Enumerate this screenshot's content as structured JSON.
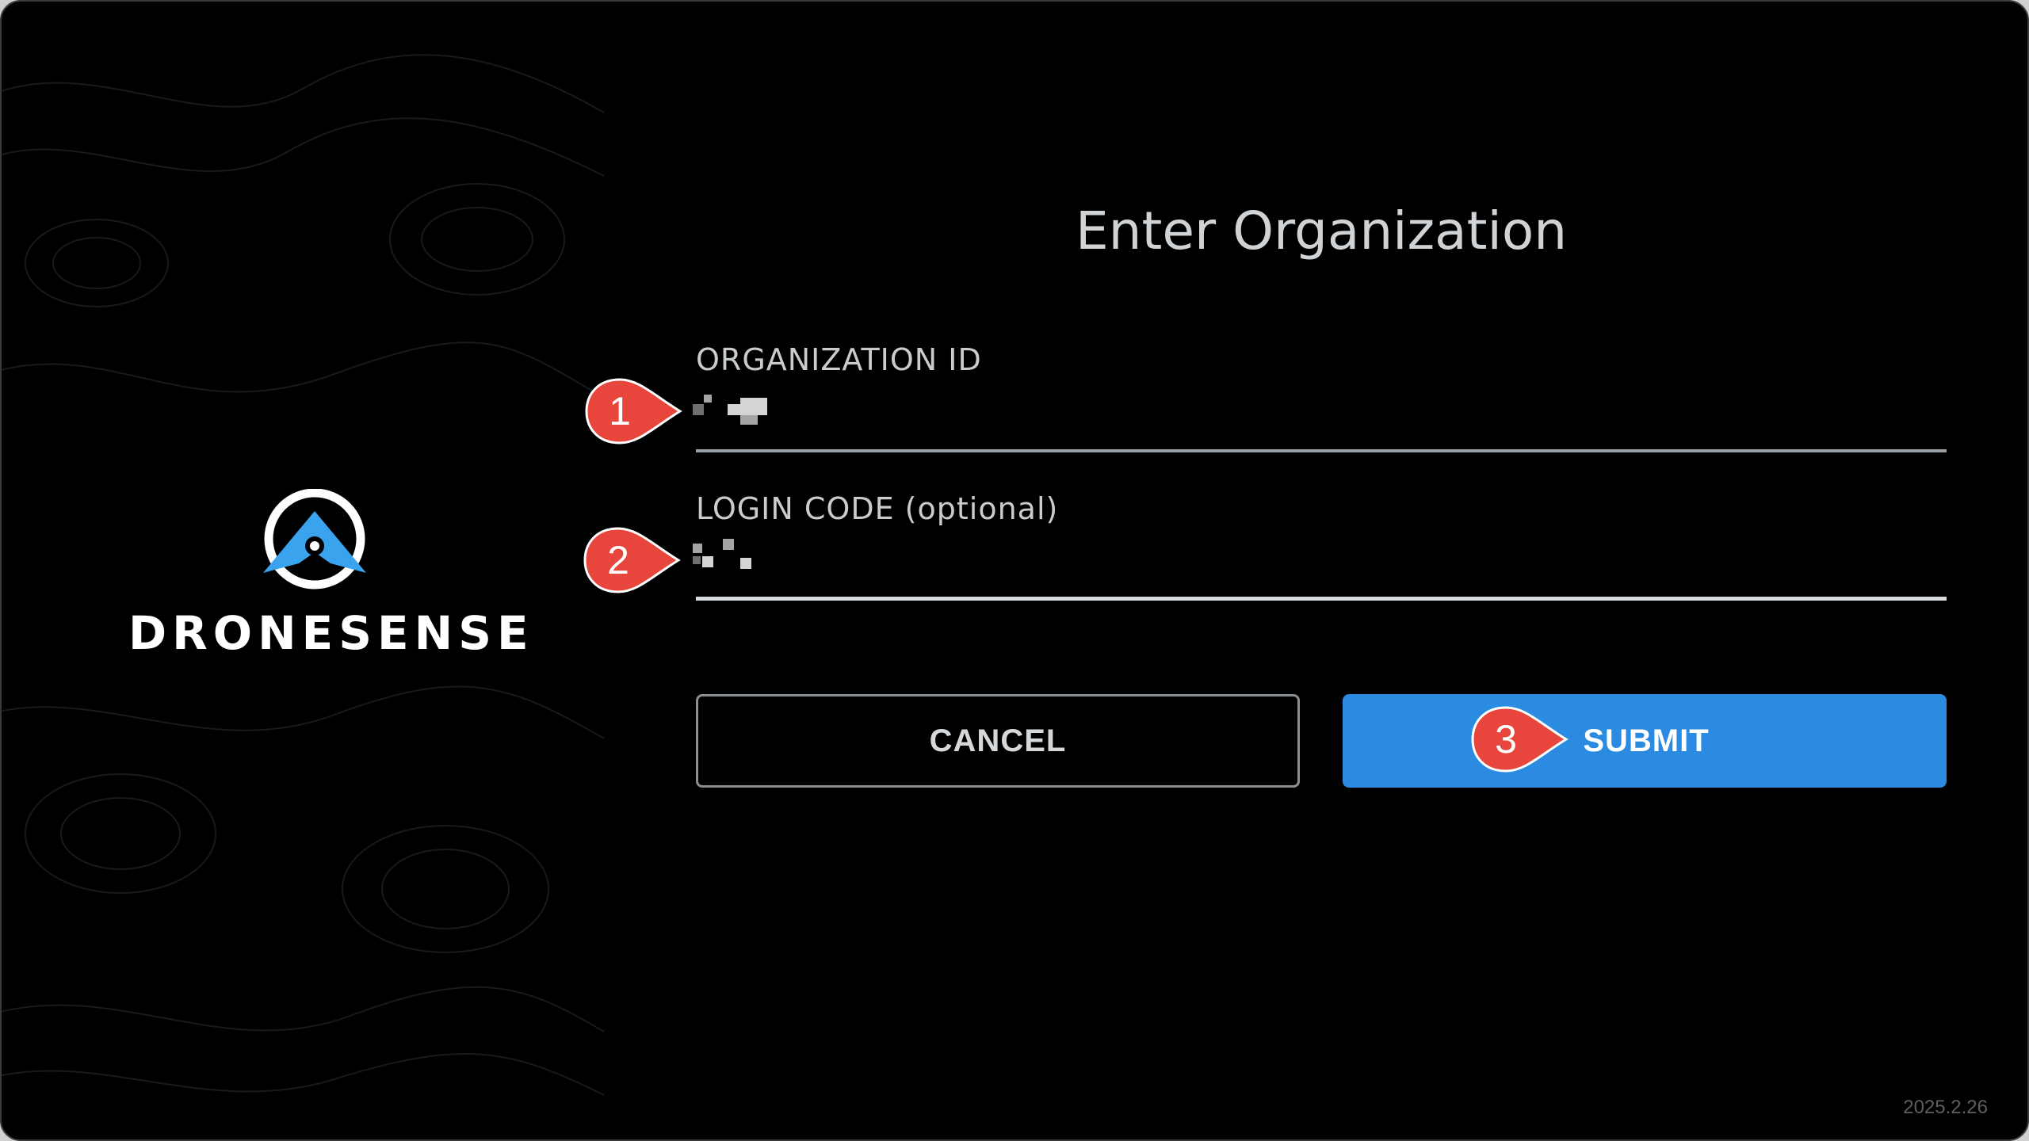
{
  "brand": {
    "name": "DRONESENSE",
    "logo_icon": "drone-location-pin-icon",
    "accent": "#3aa3ee"
  },
  "form": {
    "title": "Enter Organization",
    "org_id": {
      "label": "ORGANIZATION ID",
      "value_state": "redacted"
    },
    "login_code": {
      "label": "LOGIN CODE (optional)",
      "value_state": "redacted"
    }
  },
  "buttons": {
    "cancel_label": "CANCEL",
    "submit_label": "SUBMIT",
    "submit_color": "#2a8be0"
  },
  "annotations": [
    {
      "number": "1",
      "color": "#e8453c",
      "target": "organization-id-field"
    },
    {
      "number": "2",
      "color": "#e8453c",
      "target": "login-code-field"
    },
    {
      "number": "3",
      "color": "#e8453c",
      "target": "submit-button"
    }
  ],
  "footer": {
    "version": "2025.2.26"
  }
}
